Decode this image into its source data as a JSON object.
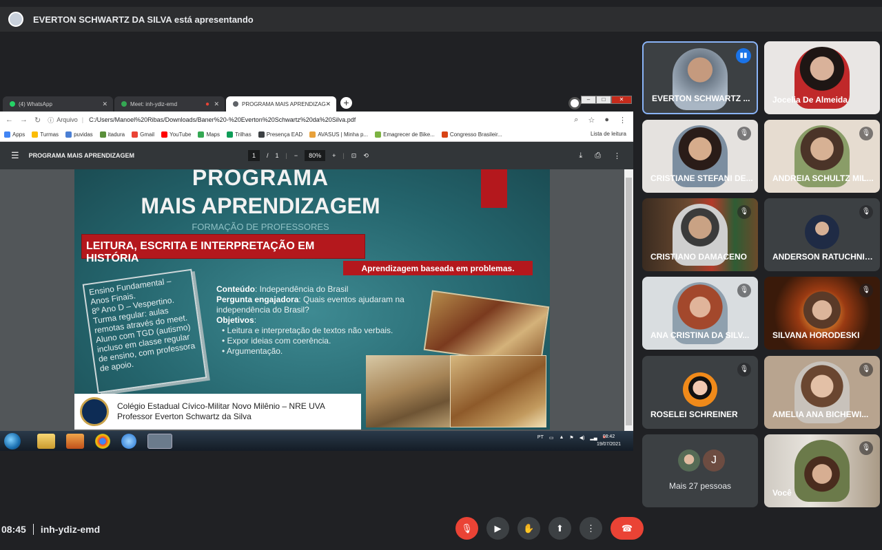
{
  "presenting": {
    "text": "EVERTON SCHWARTZ DA SILVA está apresentando"
  },
  "browser": {
    "tabs": [
      {
        "label": "(4) WhatsApp"
      },
      {
        "label": "Meet: inh-ydiz-emd"
      },
      {
        "label": "PROGRAMA MAIS APRENDIZAG"
      }
    ],
    "address_prefix": "Arquivo",
    "url": "C:/Users/Manoel%20Ribas/Downloads/Baner%20-%20Everton%20Schwartz%20da%20Silva.pdf",
    "bookmarks": [
      "Apps",
      "Turmas",
      "puvidas",
      "itadura",
      "Gmail",
      "YouTube",
      "Maps",
      "Trilhas",
      "Presença EAD",
      "AVASUS | Minha p...",
      "Emagrecer de Bike...",
      "Congresso Brasileir..."
    ],
    "reading_list": "Lista de leitura"
  },
  "pdf": {
    "title": "PROGRAMA MAIS APRENDIZAGEM",
    "page_current": "1",
    "page_sep": "/",
    "page_total": "1",
    "zoom": "80%"
  },
  "slide": {
    "title1": "PROGRAMA",
    "title2": "MAIS APRENDIZAGEM",
    "subtitle": "FORMAÇÃO DE PROFESSORES",
    "banner1": "LEITURA, ESCRITA E INTERPRETAÇÃO EM HISTÓRIA",
    "banner2": "Aprendizagem baseada em problemas.",
    "note_lines": [
      "Ensino Fundamental –",
      "Anos Finais.",
      "8º Ano D – Vespertino.",
      "Turma regular: aulas",
      "remotas através do meet.",
      "Aluno com TGD (autismo)",
      "incluso em classe regular",
      "de ensino, com professora",
      "de apoio."
    ],
    "conteudo_label": "Conteúdo",
    "conteudo_text": ": Independência do Brasil",
    "pergunta_label": "Pergunta engajadora",
    "pergunta_text": ": Quais eventos ajudaram na independência do Brasil?",
    "objetivos_label": "Objetivos",
    "objetivos": [
      "Leitura e interpretação de textos não verbais.",
      "Expor ideias com coerência.",
      "Argumentação."
    ],
    "footer_line1": "Colégio Estadual Cívico-Militar Novo Milênio – NRE UVA",
    "footer_line2": "Professor Everton Schwartz da Silva"
  },
  "taskbar": {
    "lang": "PT",
    "time": "08:42",
    "date": "19/07/2021"
  },
  "participants": [
    {
      "name": "EVERTON SCHWARTZ ...",
      "muted": false,
      "speaking": true
    },
    {
      "name": "Jocelia De Almeida",
      "muted": false
    },
    {
      "name": "CRISTIANE STEFANI DE...",
      "muted": true
    },
    {
      "name": "ANDREIA SCHULTZ MIL...",
      "muted": true
    },
    {
      "name": "CRISTIANO DAMACENO",
      "muted": true
    },
    {
      "name": "ANDERSON RATUCHNIAK",
      "muted": true
    },
    {
      "name": "ANA CRISTINA DA SILV...",
      "muted": true
    },
    {
      "name": "SILVANA HORODESKI",
      "muted": true
    },
    {
      "name": "ROSELEI SCHREINER",
      "muted": true
    },
    {
      "name": "AMELIA ANA BICHEWI...",
      "muted": true
    },
    {
      "name": "Você",
      "muted": true
    }
  ],
  "more": {
    "initial": "J",
    "text": "Mais 27 pessoas"
  },
  "meeting": {
    "time": "08:45",
    "code": "inh-ydiz-emd"
  },
  "icons": {
    "mic_off": "mic-off-icon",
    "camera": "camera-icon",
    "hand": "raise-hand-icon",
    "present": "present-icon",
    "more": "more-vert-icon",
    "hangup": "hangup-icon"
  },
  "colors": {
    "accent": "#8ab4f8",
    "danger": "#ea4335",
    "banner_red": "#b4181d"
  }
}
